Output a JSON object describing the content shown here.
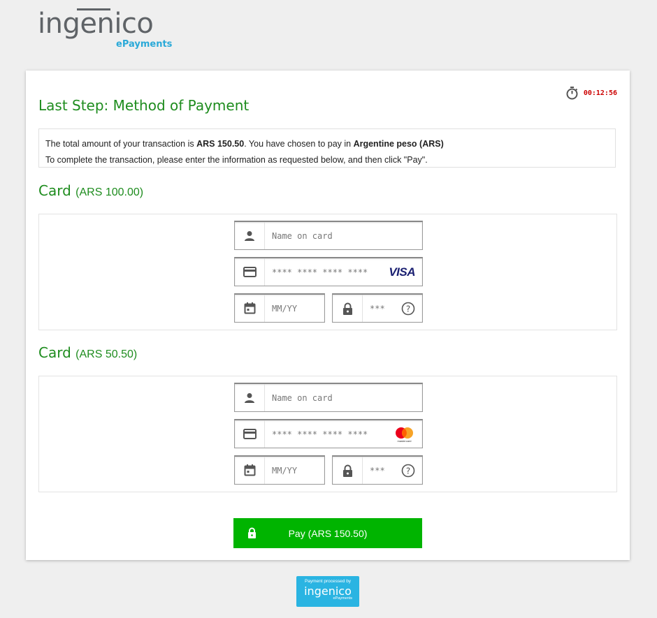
{
  "brand": {
    "name": "ingenico",
    "sub": "ePayments"
  },
  "timer": {
    "value": "00:12:56",
    "icon": "stopwatch-icon"
  },
  "title": "Last Step: Method of Payment",
  "info": {
    "line1_pre": "The total amount of your transaction is ",
    "amount": "ARS 150.50",
    "line1_mid": ". You have chosen to pay in ",
    "currency": "Argentine peso (ARS)",
    "line2": "To complete the transaction, please enter the information as requested below, and then click \"Pay\"."
  },
  "cards": [
    {
      "title": "Card",
      "amount": "(ARS 100.00)",
      "name_placeholder": "Name on card",
      "number_placeholder": "**** **** **** ****",
      "brand": "VISA",
      "expiry_placeholder": "MM/YY",
      "cvv_placeholder": "***"
    },
    {
      "title": "Card",
      "amount": "(ARS 50.50)",
      "name_placeholder": "Name on card",
      "number_placeholder": "**** **** **** ****",
      "brand": "mastercard",
      "expiry_placeholder": "MM/YY",
      "cvv_placeholder": "***"
    }
  ],
  "pay_button": "Pay (ARS 150.50)",
  "footer_badge": {
    "line1": "Payment processed by",
    "brand": "ingenico",
    "sub": "ePayments"
  },
  "colors": {
    "accent_green": "#1e8c1e",
    "pay_green": "#00b400",
    "timer_red": "#cc0000",
    "brand_blue": "#2aa9d8"
  }
}
